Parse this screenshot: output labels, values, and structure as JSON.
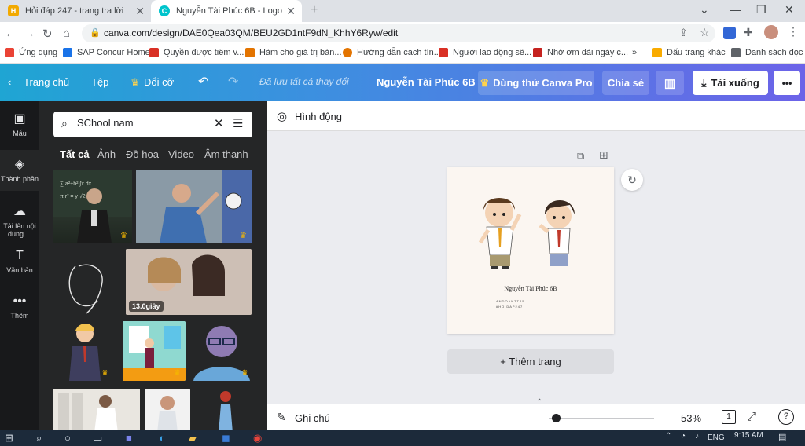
{
  "browser": {
    "tabs": [
      {
        "title": "Hỏi đáp 247 - trang tra lời",
        "active": false,
        "favicon_color": "#f2a900"
      },
      {
        "title": "Nguyễn Tài Phúc 6B - Logo",
        "active": true,
        "favicon_color": "#00c4cc"
      }
    ],
    "new_tab": "+",
    "url": "canva.com/design/DAE0Qea03QM/BEU2GD1ntF9dN_KhhY6Ryw/edit",
    "bookmarks": [
      {
        "label": "Ứng dụng",
        "color": "#ea4335"
      },
      {
        "label": "SAP Concur Home",
        "color": "#1a73e8"
      },
      {
        "label": "Quyền được tiêm v...",
        "color": "#d93025"
      },
      {
        "label": "Hàm cho giá trị bản...",
        "color": "#e37400"
      },
      {
        "label": "Hướng dẫn cách tín...",
        "color": "#e37400"
      },
      {
        "label": "Người lao động sẽ...",
        "color": "#d93025"
      },
      {
        "label": "Nhớ ơm dài ngày c...",
        "color": "#c5221f"
      },
      {
        "label": "»",
        "color": ""
      },
      {
        "label": "Dấu trang khác",
        "color": "#f9ab00"
      },
      {
        "label": "Danh sách đọc",
        "color": "#5f6368"
      }
    ]
  },
  "header": {
    "home": "Trang chủ",
    "file": "Tệp",
    "resize": "Đổi cỡ",
    "saved": "Đã lưu tất cả thay đổi",
    "title": "Nguyễn Tài Phúc 6B",
    "pro": "Dùng thử Canva Pro",
    "share": "Chia sẻ",
    "download": "Tải xuống",
    "more": "•••"
  },
  "rail": [
    {
      "label": "Mẫu",
      "icon": "template-icon"
    },
    {
      "label": "Thành phần",
      "icon": "elements-icon"
    },
    {
      "label": "Tải lên nội dung ...",
      "icon": "upload-icon"
    },
    {
      "label": "Văn bản",
      "icon": "text-icon"
    },
    {
      "label": "Thêm",
      "icon": "more-icon"
    }
  ],
  "panel": {
    "search_value": "SChool nam",
    "tabs": [
      "Tất cả",
      "Ảnh",
      "Đồ họa",
      "Video",
      "Âm thanh"
    ],
    "video_duration": "13.0giây"
  },
  "workspace": {
    "animate": "Hình động",
    "design_name": "Nguyễn Tài Phúc 6B",
    "design_small1": "ANDOANTT45",
    "design_small2": "#HOIDAP247",
    "add_page": "+ Thêm trang",
    "notes": "Ghi chú",
    "zoom": "53%",
    "zoom_level": 0.53,
    "page_count": "1"
  },
  "taskbar": {
    "time": "9:15 AM",
    "lang": "ENG"
  }
}
